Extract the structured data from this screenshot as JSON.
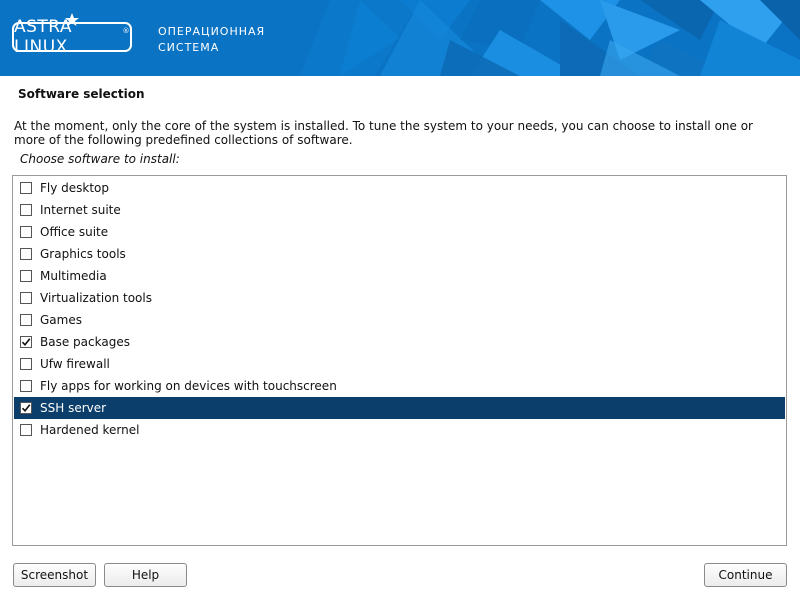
{
  "banner": {
    "logo_text": "ASTRA LINUX",
    "logo_mark": "®",
    "subtitle_line1": "ОПЕРАЦИОННАЯ",
    "subtitle_line2": "СИСТЕМА",
    "colors": {
      "background": "#0a73c4",
      "text": "#ffffff"
    }
  },
  "page": {
    "title": "Software selection",
    "description": "At the moment, only the core of the system is installed. To tune the system to your needs, you can choose to install one or more of the following predefined collections of software.",
    "prompt": "Choose software to install:"
  },
  "software": {
    "items": [
      {
        "label": "Fly desktop",
        "checked": false,
        "selected": false
      },
      {
        "label": "Internet suite",
        "checked": false,
        "selected": false
      },
      {
        "label": "Office suite",
        "checked": false,
        "selected": false
      },
      {
        "label": "Graphics tools",
        "checked": false,
        "selected": false
      },
      {
        "label": "Multimedia",
        "checked": false,
        "selected": false
      },
      {
        "label": "Virtualization tools",
        "checked": false,
        "selected": false
      },
      {
        "label": "Games",
        "checked": false,
        "selected": false
      },
      {
        "label": "Base packages",
        "checked": true,
        "selected": false
      },
      {
        "label": "Ufw firewall",
        "checked": false,
        "selected": false
      },
      {
        "label": "Fly apps for working on devices with touchscreen",
        "checked": false,
        "selected": false
      },
      {
        "label": "SSH server",
        "checked": true,
        "selected": true
      },
      {
        "label": "Hardened kernel",
        "checked": false,
        "selected": false
      }
    ],
    "selection_color": "#0b3e6a"
  },
  "buttons": {
    "screenshot": "Screenshot",
    "help": "Help",
    "continue": "Continue"
  }
}
